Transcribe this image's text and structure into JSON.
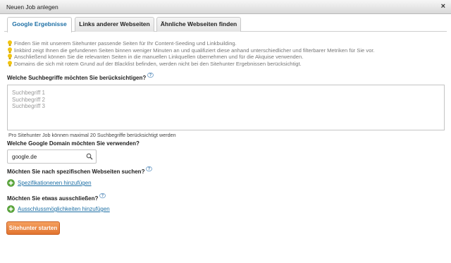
{
  "window": {
    "title": "Neuen Job anlegen",
    "close_symbol": "×"
  },
  "tabs": [
    {
      "label": "Google Ergebnisse",
      "active": true
    },
    {
      "label": "Links anderer Webseiten",
      "active": false
    },
    {
      "label": "Ähnliche Webseiten finden",
      "active": false
    }
  ],
  "info": [
    "Finden Sie mit unserem Sitehunter passende Seiten für Ihr Content-Seeding und Linkbuilding.",
    "linkbird zeigt Ihnen die gefundenen Seiten binnen weniger Minuten an und qualifiziert diese anhand unterschiedlicher und filterbarer Metriken für Sie vor.",
    "Anschließend können Sie die relevanten Seiten in die manuellen Linkquellen übernehmen und für die Akquise verwenden.",
    "Domains die sich mit rotem Grund auf der Blacklist befinden, werden nicht bei den Sitehunter Ergebnissen berücksichtigt."
  ],
  "keywords": {
    "label": "Welche Suchbegriffe möchten Sie berücksichtigen?",
    "placeholder": "Suchbegriff 1\nSuchbegriff 2\nSuchbegriff 3",
    "hint": "Pro Sitehunter Job können maximal 20 Suchbegriffe berücksichtigt werden"
  },
  "domain": {
    "label": "Welche Google Domain möchten Sie verwenden?",
    "value": "google.de"
  },
  "specific": {
    "label": "Möchten Sie nach spezifischen Webseiten suchen?",
    "link": "Spezifikationenen hinzufügen"
  },
  "exclude": {
    "label": "Möchten Sie etwas ausschließen?",
    "link": "Ausschlussmöglichkeiten hinzufügen"
  },
  "start_button": "Sitehunter starten",
  "colors": {
    "accent": "#1d6fa5",
    "button": "#e98a45",
    "plus": "#5aa83a",
    "bulb": "#f2c40f"
  }
}
